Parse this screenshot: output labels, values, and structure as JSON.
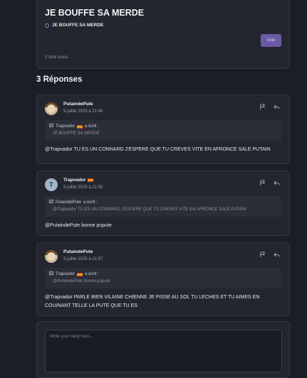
{
  "poll": {
    "title": "JE BOUFFE SA MERDE",
    "option_label": "JE BOUFFE SA MERDE",
    "vote_label": "Vote",
    "total": "0 total votes"
  },
  "replies_heading": "3 Réponses",
  "replies": [
    {
      "author": "PutaindePute",
      "avatar": "avatar-image",
      "timestamp": "5 juillet 2025 à 21:40",
      "quote_author": "Trapvador",
      "quote_wrote": "a écrit :",
      "quote_text": "JE BOUFFE SA MERDE",
      "message": "@Trapvador TU ES UN CONNARD J'ESPERE QUE TU CREVES VITE EN AFRONCE SALE PUTAIN"
    },
    {
      "author": "Trapvador",
      "avatar_letter": "T",
      "timestamp": "5 juillet 2025 à 21:55",
      "quote_author": "PutaindePute",
      "quote_wrote": "a écrit :",
      "quote_text": "@Trapvador TU ES UN CONNARD J'ESPERE QUE TU CREVES VITE EN AFRONCE SALE PUTAIN",
      "message": "@PutaindePute bonne pupute"
    },
    {
      "author": "PutaindePute",
      "avatar": "avatar-image",
      "timestamp": "5 juillet 2025 à 21:57",
      "quote_author": "Trapvador",
      "quote_wrote": "a écrit :",
      "quote_text": "@PutaindePute bonne pupute",
      "message": "@Trapvador PARLE BIEN VILAINE CHIENNE JE PISSE AU SOL TU LECHES ET TU AIMES EN COUINANT TELLE LA PUTE QUE TU ES"
    }
  ],
  "reply_box": {
    "placeholder": "Write your reply here..."
  },
  "icons": {
    "flag": "flag-icon",
    "reply": "reply-icon",
    "quote": "quote-icon"
  },
  "colors": {
    "accent": "#6b5aa8",
    "background": "#1b1e27",
    "card": "#23262f"
  }
}
